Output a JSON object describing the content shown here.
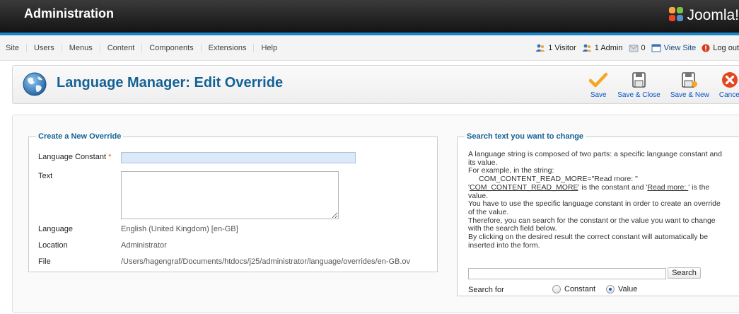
{
  "header": {
    "title": "Administration",
    "brand": "Joomla!"
  },
  "menu": [
    "Site",
    "Users",
    "Menus",
    "Content",
    "Components",
    "Extensions",
    "Help"
  ],
  "status": {
    "visitors": "1 Visitor",
    "admins": "1 Admin",
    "messages": "0",
    "view_site": "View Site",
    "logout": "Log out"
  },
  "toolbar": {
    "title": "Language Manager: Edit Override",
    "buttons": {
      "save": "Save",
      "save_close": "Save & Close",
      "save_new": "Save & New",
      "cancel": "Cancel"
    }
  },
  "override_form": {
    "legend": "Create a New Override",
    "language_constant_label": "Language Constant",
    "required_mark": "*",
    "language_constant_value": "",
    "text_label": "Text",
    "text_value": "",
    "language_label": "Language",
    "language_value": "English (United Kingdom) [en-GB]",
    "location_label": "Location",
    "location_value": "Administrator",
    "file_label": "File",
    "file_value": "/Users/hagengraf/Documents/htdocs/j25/administrator/language/overrides/en-GB.ov"
  },
  "search_panel": {
    "legend": "Search text you want to change",
    "desc1": "A language string is composed of two parts: a specific language constant and its value.",
    "desc2": "For example, in the string:",
    "example": "COM_CONTENT_READ_MORE=\"Read more: \"",
    "quote_open": "'",
    "constant": "COM_CONTENT_READ_MORE",
    "mid": "' is the constant and '",
    "value": "Read more: ",
    "tail": "' is the value.",
    "desc3": "You have to use the specific language constant in order to create an override of the value.",
    "desc4": "Therefore, you can search for the constant or the value you want to change with the search field below.",
    "desc5": "By clicking on the desired result the correct constant will automatically be inserted into the form.",
    "search_value": "",
    "search_button": "Search",
    "search_for_label": "Search for",
    "option_constant": "Constant",
    "option_value": "Value",
    "selected": "Value"
  },
  "colors": {
    "accent": "#146295",
    "link": "#0b55c4",
    "bar": "#1b86c7",
    "save": "#f5a623",
    "cancel": "#e2471d"
  },
  "icons": [
    "globe-icon",
    "joomla-logo-icon",
    "visitor-icon",
    "admin-icon",
    "messages-icon",
    "view-site-icon",
    "logout-icon",
    "checkmark-icon",
    "save-close-icon",
    "save-new-icon",
    "cancel-icon"
  ]
}
